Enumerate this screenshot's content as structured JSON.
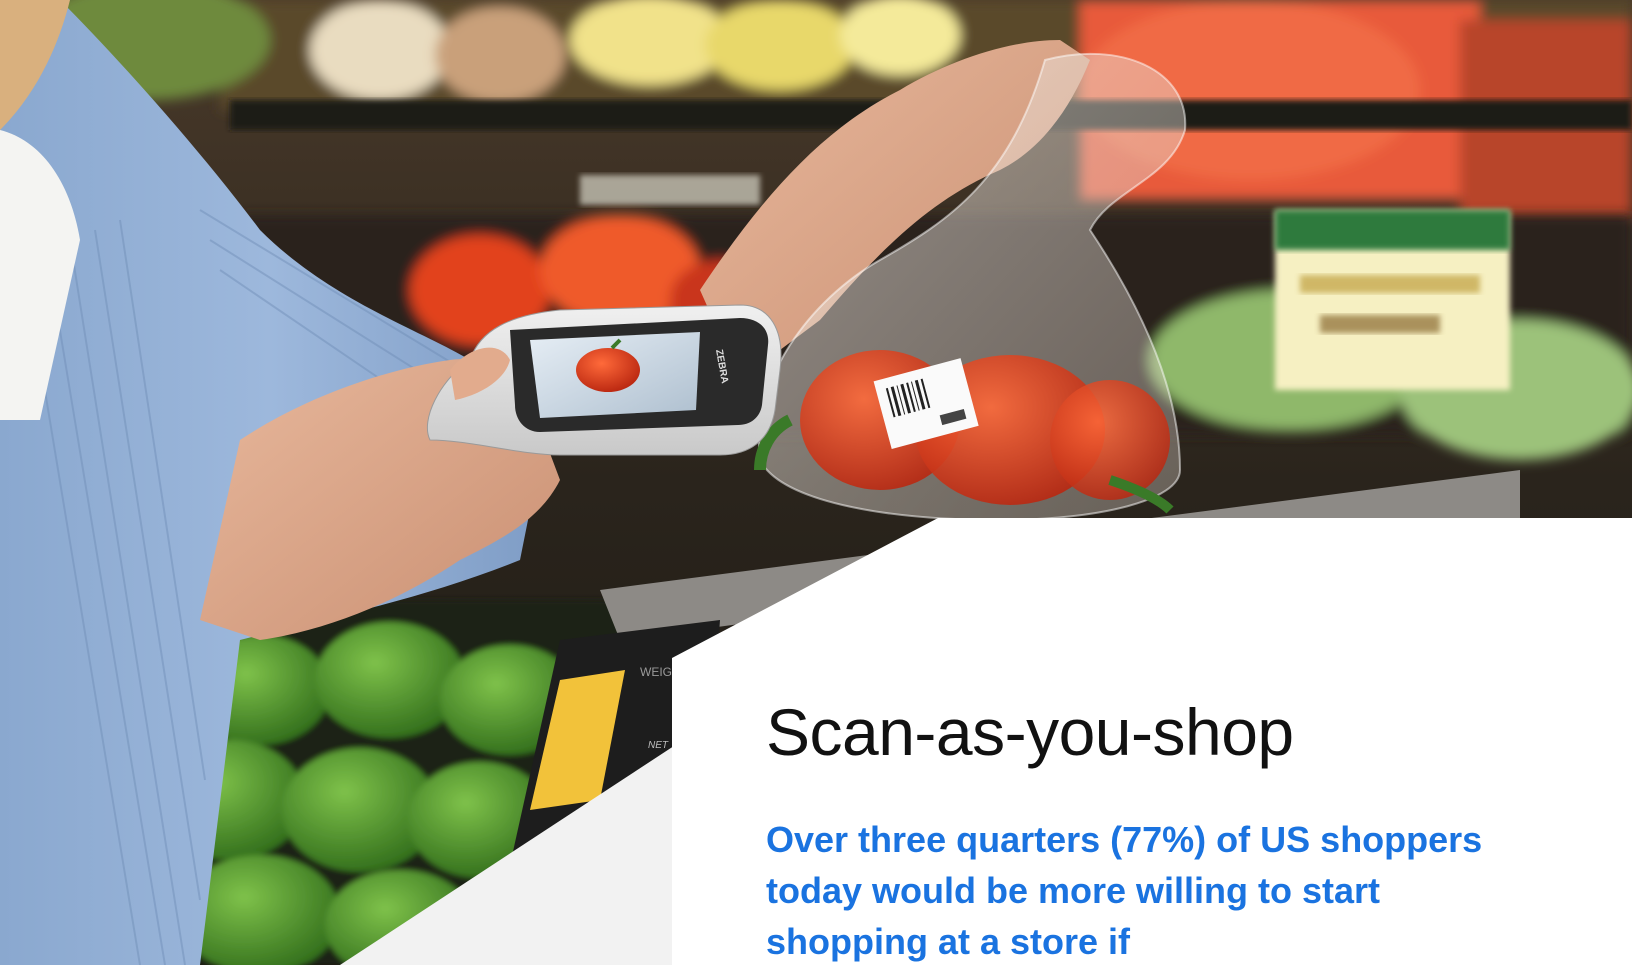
{
  "article": {
    "title": "Scan-as-you-shop",
    "stat_text": "Over three quarters (77%) of US shoppers today would be more willing to start shopping at a store if"
  },
  "photo": {
    "scanner_brand": "ZEBRA",
    "scale_label_1": "WEIG",
    "scale_label_2": "NET"
  },
  "colors": {
    "accent_blue": "#1a73e0",
    "headline": "#111111",
    "card_white": "#ffffff",
    "card_grey": "#f2f2f2"
  }
}
